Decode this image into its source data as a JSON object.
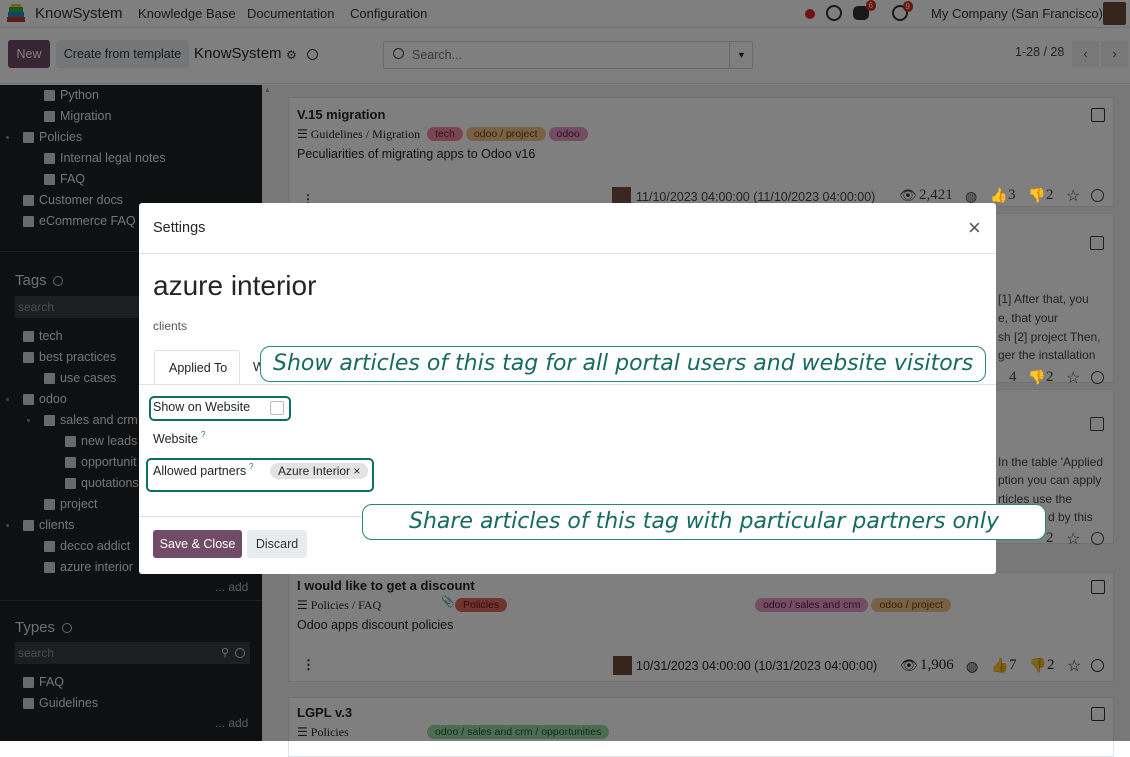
{
  "navbar": {
    "app_name": "KnowSystem",
    "menu": [
      "Knowledge Base",
      "Documentation",
      "Configuration"
    ],
    "chat_badge": "6",
    "activity_badge": "9",
    "company": "My Company (San Francisco)"
  },
  "control_panel": {
    "new_label": "New",
    "template_label": "Create from template",
    "title": "KnowSystem",
    "search_placeholder": "Search...",
    "pager": "1-28 / 28"
  },
  "sidebar": {
    "top_items": [
      "Python",
      "Migration",
      "Policies",
      "Internal legal notes",
      "FAQ",
      "Customer docs",
      "eCommerce FAQ"
    ],
    "tags_title": "Tags",
    "tags_search_placeholder": "search",
    "tags": [
      "tech",
      "best practices",
      "use cases",
      "odoo",
      "sales and crm",
      "new leads",
      "opportunit",
      "quotations",
      "project",
      "clients",
      "decco addict",
      "azure interior"
    ],
    "add_label": "... add",
    "types_title": "Types",
    "types_search_placeholder": "search",
    "types": [
      "FAQ",
      "Guidelines"
    ]
  },
  "cards": [
    {
      "title": "V.15 migration",
      "section": "Guidelines / Migration",
      "tags": [
        "tech",
        "odoo / project",
        "odoo"
      ],
      "desc": "Peculiarities of migrating apps to Odoo v16",
      "date": "11/10/2023 04:00:00 (11/10/2023 04:00:00)",
      "views": "2,421",
      "likes": "3",
      "dislikes": "2"
    },
    {
      "snippet": [
        "[1] After that, you",
        "e, that your",
        "sh [2] project Then,",
        "ger the installation"
      ],
      "likes": "4",
      "dislikes": "2"
    },
    {
      "snippet": [
        "In the table 'Applied",
        "ption you can apply",
        "rticles use the",
        "d by this"
      ],
      "dislikes": "2"
    },
    {
      "title": "I would like to get a discount",
      "section": "Policies / FAQ",
      "tags": [
        "Policies"
      ],
      "tags_right": [
        "odoo / sales and crm",
        "odoo / project"
      ],
      "desc": "Odoo apps discount policies",
      "date": "10/31/2023 04:00:00 (10/31/2023 04:00:00)",
      "views": "1,906",
      "likes": "7",
      "dislikes": "2"
    },
    {
      "title": "LGPL v.3",
      "section": "Policies",
      "tags": [
        "odoo / sales and crm / opportunities"
      ]
    }
  ],
  "modal": {
    "title": "Settings",
    "record_name": "azure interior",
    "parent": "clients",
    "tab_applied": "Applied To",
    "tab_second": "W",
    "show_on_website_label": "Show on Website",
    "website_label": "Website",
    "help_mark": "?",
    "allowed_partners_label": "Allowed partners",
    "partner_chip": "Azure Interior",
    "chip_remove": "×",
    "save_label": "Save & Close",
    "discard_label": "Discard"
  },
  "callouts": {
    "website": "Show articles of this tag for all portal users and website visitors",
    "partners": "Share articles of this tag with particular partners only"
  }
}
